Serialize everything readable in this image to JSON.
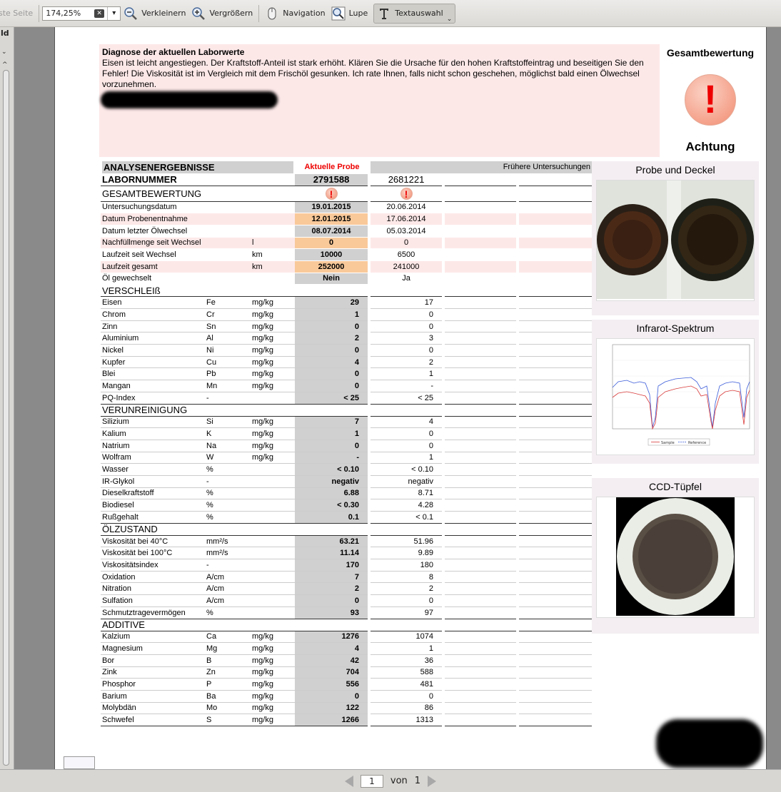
{
  "toolbar": {
    "first_page_label": "ste Seite",
    "zoom_value": "174,25%",
    "zoom_out": "Verkleinern",
    "zoom_in": "Vergrößern",
    "navigation": "Navigation",
    "magnifier": "Lupe",
    "text_select": "Textauswahl"
  },
  "sidebar": {
    "label": "ld"
  },
  "diagnosis": {
    "heading": "Diagnose der aktuellen Laborwerte",
    "text": "Eisen ist leicht angestiegen. Der Kraftstoff-Anteil ist stark erhöht. Klären Sie die Ursache für den hohen Kraftstoffeintrag und beseitigen Sie den Fehler! Die Viskosität ist im Vergleich mit dem Frischöl gesunken. Ich rate Ihnen, falls nicht schon geschehen, möglichst bald einen Ölwechsel vorzunehmen."
  },
  "overall": {
    "title": "Gesamtbewertung",
    "symbol": "!",
    "verdict": "Achtung"
  },
  "results": {
    "title": "ANALYSENERGEBNISSE",
    "current_label": "Aktuelle Probe",
    "previous_label": "Frühere Untersuchungen",
    "lab_label": "LABORNUMMER",
    "lab_current": "2791588",
    "lab_previous": "2681221",
    "overall_label": "GESAMTBEWERTUNG",
    "general": [
      {
        "name": "Untersuchungsdatum",
        "unit": "",
        "cur": "19.01.2015",
        "prev": "20.06.2014",
        "hl": false
      },
      {
        "name": "Datum Probenentnahme",
        "unit": "",
        "cur": "12.01.2015",
        "prev": "17.06.2014",
        "hl": true
      },
      {
        "name": "Datum letzter Ölwechsel",
        "unit": "",
        "cur": "08.07.2014",
        "prev": "05.03.2014",
        "hl": false
      },
      {
        "name": "Nachfüllmenge seit Wechsel",
        "unit": "l",
        "cur": "0",
        "prev": "0",
        "hl": true
      },
      {
        "name": "Laufzeit seit Wechsel",
        "unit": "km",
        "cur": "10000",
        "prev": "6500",
        "hl": false
      },
      {
        "name": "Laufzeit gesamt",
        "unit": "km",
        "cur": "252000",
        "prev": "241000",
        "hl": true
      },
      {
        "name": "Öl gewechselt",
        "unit": "",
        "cur": "Nein",
        "prev": "Ja",
        "hl": false
      }
    ],
    "sections": [
      {
        "title": "VERSCHLEIß",
        "rows": [
          {
            "name": "Eisen",
            "sym": "Fe",
            "unit": "mg/kg",
            "cur": "29",
            "prev": "17"
          },
          {
            "name": "Chrom",
            "sym": "Cr",
            "unit": "mg/kg",
            "cur": "1",
            "prev": "0"
          },
          {
            "name": "Zinn",
            "sym": "Sn",
            "unit": "mg/kg",
            "cur": "0",
            "prev": "0"
          },
          {
            "name": "Aluminium",
            "sym": "Al",
            "unit": "mg/kg",
            "cur": "2",
            "prev": "3"
          },
          {
            "name": "Nickel",
            "sym": "Ni",
            "unit": "mg/kg",
            "cur": "0",
            "prev": "0"
          },
          {
            "name": "Kupfer",
            "sym": "Cu",
            "unit": "mg/kg",
            "cur": "4",
            "prev": "2"
          },
          {
            "name": "Blei",
            "sym": "Pb",
            "unit": "mg/kg",
            "cur": "0",
            "prev": "1"
          },
          {
            "name": "Mangan",
            "sym": "Mn",
            "unit": "mg/kg",
            "cur": "0",
            "prev": "-"
          },
          {
            "name": "PQ-Index",
            "sym": "-",
            "unit": "",
            "cur": "< 25",
            "prev": "< 25"
          }
        ]
      },
      {
        "title": "VERUNREINIGUNG",
        "rows": [
          {
            "name": "Silizium",
            "sym": "Si",
            "unit": "mg/kg",
            "cur": "7",
            "prev": "4"
          },
          {
            "name": "Kalium",
            "sym": "K",
            "unit": "mg/kg",
            "cur": "1",
            "prev": "0"
          },
          {
            "name": "Natrium",
            "sym": "Na",
            "unit": "mg/kg",
            "cur": "0",
            "prev": "0"
          },
          {
            "name": "Wolfram",
            "sym": "W",
            "unit": "mg/kg",
            "cur": "-",
            "prev": "1"
          },
          {
            "name": "Wasser",
            "sym": "%",
            "unit": "",
            "cur": "< 0.10",
            "prev": "< 0.10"
          },
          {
            "name": "IR-Glykol",
            "sym": "-",
            "unit": "",
            "cur": "negativ",
            "prev": "negativ"
          },
          {
            "name": "Dieselkraftstoff",
            "sym": "%",
            "unit": "",
            "cur": "6.88",
            "prev": "8.71"
          },
          {
            "name": "Biodiesel",
            "sym": "%",
            "unit": "",
            "cur": "< 0.30",
            "prev": "4.28"
          },
          {
            "name": "Rußgehalt",
            "sym": "%",
            "unit": "",
            "cur": "0.1",
            "prev": "< 0.1"
          }
        ]
      },
      {
        "title": "ÖLZUSTAND",
        "rows": [
          {
            "name": "Viskosität bei 40°C",
            "sym": "mm²/s",
            "unit": "",
            "cur": "63.21",
            "prev": "51.96"
          },
          {
            "name": "Viskosität bei 100°C",
            "sym": "mm²/s",
            "unit": "",
            "cur": "11.14",
            "prev": "9.89"
          },
          {
            "name": "Viskositätsindex",
            "sym": "-",
            "unit": "",
            "cur": "170",
            "prev": "180"
          },
          {
            "name": "Oxidation",
            "sym": "A/cm",
            "unit": "",
            "cur": "7",
            "prev": "8"
          },
          {
            "name": "Nitration",
            "sym": "A/cm",
            "unit": "",
            "cur": "2",
            "prev": "2"
          },
          {
            "name": "Sulfation",
            "sym": "A/cm",
            "unit": "",
            "cur": "0",
            "prev": "0"
          },
          {
            "name": "Schmutztragevermögen",
            "sym": "%",
            "unit": "",
            "cur": "93",
            "prev": "97"
          }
        ]
      },
      {
        "title": "ADDITIVE",
        "rows": [
          {
            "name": "Kalzium",
            "sym": "Ca",
            "unit": "mg/kg",
            "cur": "1276",
            "prev": "1074"
          },
          {
            "name": "Magnesium",
            "sym": "Mg",
            "unit": "mg/kg",
            "cur": "4",
            "prev": "1"
          },
          {
            "name": "Bor",
            "sym": "B",
            "unit": "mg/kg",
            "cur": "42",
            "prev": "36"
          },
          {
            "name": "Zink",
            "sym": "Zn",
            "unit": "mg/kg",
            "cur": "704",
            "prev": "588"
          },
          {
            "name": "Phosphor",
            "sym": "P",
            "unit": "mg/kg",
            "cur": "556",
            "prev": "481"
          },
          {
            "name": "Barium",
            "sym": "Ba",
            "unit": "mg/kg",
            "cur": "0",
            "prev": "0"
          },
          {
            "name": "Molybdän",
            "sym": "Mo",
            "unit": "mg/kg",
            "cur": "122",
            "prev": "86"
          },
          {
            "name": "Schwefel",
            "sym": "S",
            "unit": "mg/kg",
            "cur": "1266",
            "prev": "1313"
          }
        ]
      }
    ]
  },
  "panels": {
    "sample": "Probe und Deckel",
    "ir": "Infrarot-Spektrum",
    "ccd": "CCD-Tüpfel",
    "ir_legend_sample": "Sample",
    "ir_legend_reference": "Reference"
  },
  "pager": {
    "current": "1",
    "of_label": "von",
    "total": "1"
  }
}
